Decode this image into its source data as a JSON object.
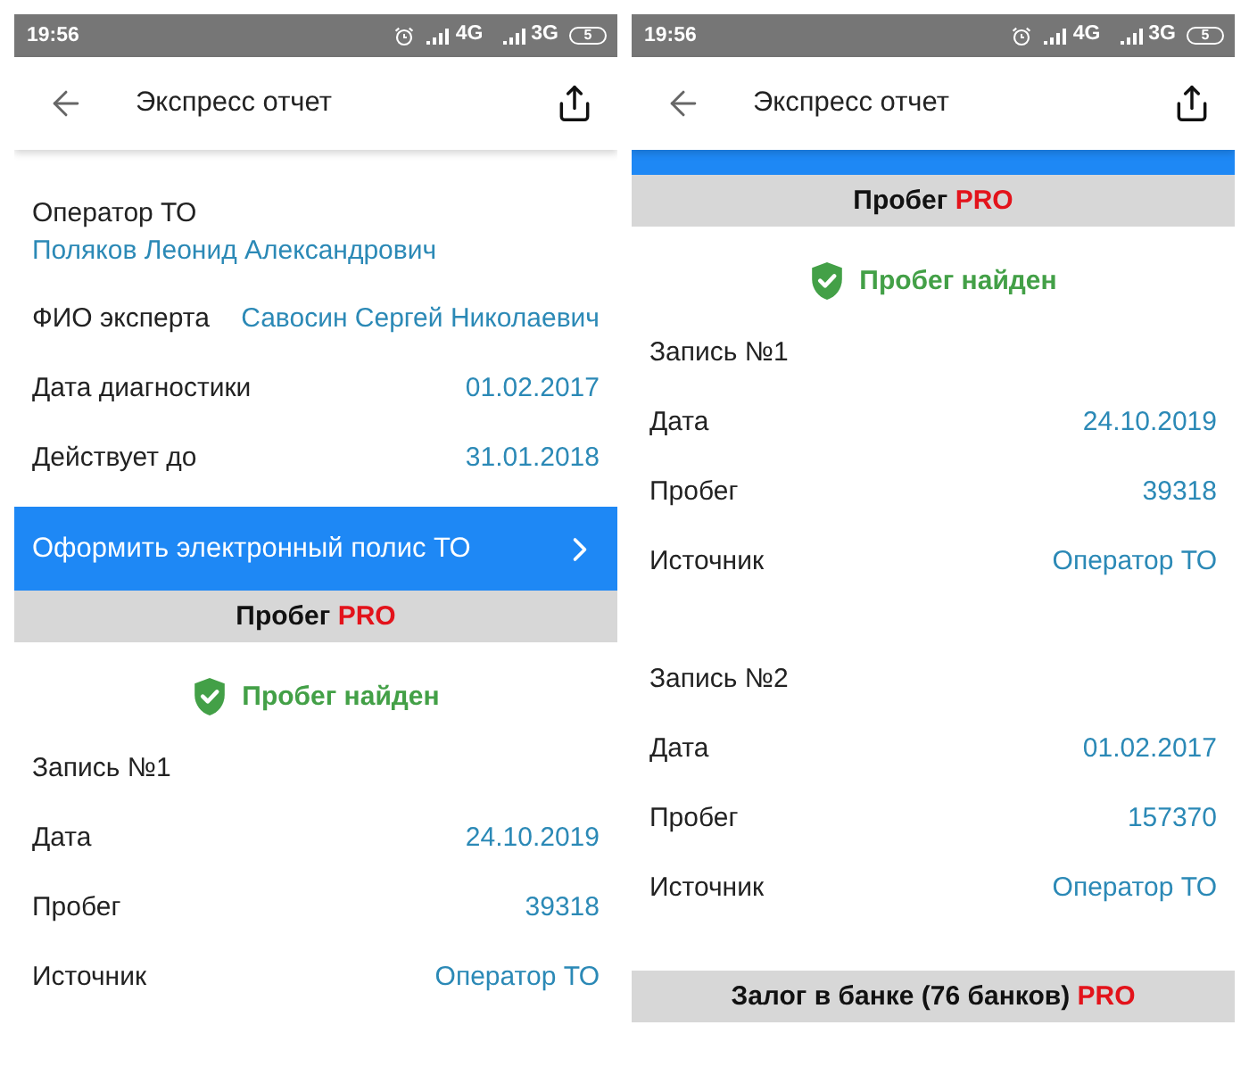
{
  "screens": [
    {
      "status_bar": {
        "time": "19:56",
        "network_1": "4G",
        "network_2": "3G",
        "battery": "5"
      },
      "app_bar": {
        "title": "Экспресс отчет"
      },
      "content": [
        {
          "kind": "stacked",
          "label": "Оператор ТО",
          "value": "Поляков Леонид Александрович"
        },
        {
          "kind": "row",
          "label": "ФИО эксперта",
          "value": "Савосин Сергей Николаевич"
        },
        {
          "kind": "row",
          "label": "Дата диагностики",
          "value": "01.02.2017"
        },
        {
          "kind": "row",
          "label": "Действует до",
          "value": "31.01.2018"
        },
        {
          "kind": "action",
          "label": "Оформить электронный полис ТО"
        },
        {
          "kind": "section",
          "title": "Пробег",
          "tag": "PRO"
        },
        {
          "kind": "status",
          "text": "Пробег найден"
        },
        {
          "kind": "record",
          "title": "Запись №1",
          "fields": [
            {
              "label": "Дата",
              "value": "24.10.2019"
            },
            {
              "label": "Пробег",
              "value": "39318"
            },
            {
              "label": "Источник",
              "value": "Оператор ТО"
            }
          ]
        }
      ]
    },
    {
      "status_bar": {
        "time": "19:56",
        "network_1": "4G",
        "network_2": "3G",
        "battery": "5"
      },
      "app_bar": {
        "title": "Экспресс отчет"
      },
      "content": [
        {
          "kind": "action",
          "cut": true
        },
        {
          "kind": "section",
          "title": "Пробег",
          "tag": "PRO"
        },
        {
          "kind": "status",
          "text": "Пробег найден"
        },
        {
          "kind": "record",
          "title": "Запись №1",
          "fields": [
            {
              "label": "Дата",
              "value": "24.10.2019"
            },
            {
              "label": "Пробег",
              "value": "39318"
            },
            {
              "label": "Источник",
              "value": "Оператор ТО"
            }
          ]
        },
        {
          "kind": "record",
          "title": "Запись №2",
          "fields": [
            {
              "label": "Дата",
              "value": "01.02.2017"
            },
            {
              "label": "Пробег",
              "value": "157370"
            },
            {
              "label": "Источник",
              "value": "Оператор ТО"
            }
          ]
        },
        {
          "kind": "section",
          "title": "Залог в банке (76 банков)",
          "tag": "PRO"
        }
      ]
    }
  ]
}
